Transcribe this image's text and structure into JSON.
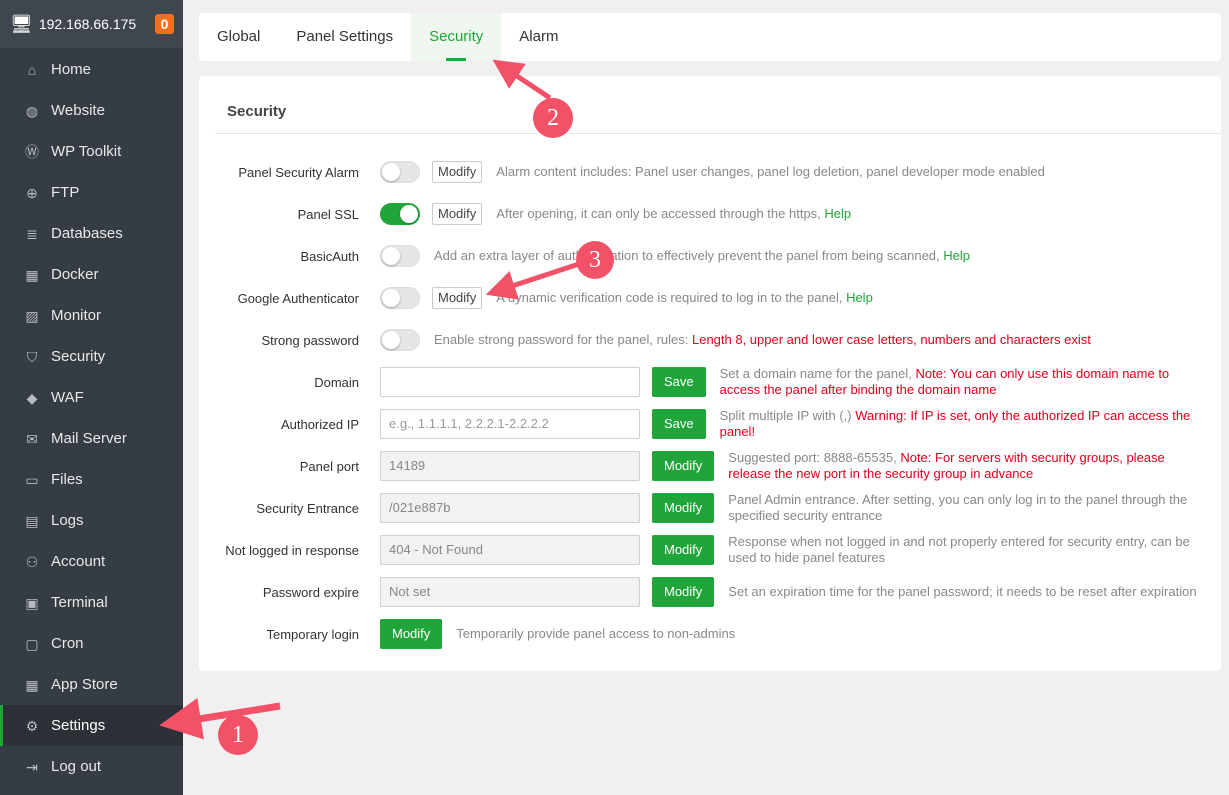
{
  "header": {
    "ip": "192.168.66.175",
    "badge": "0"
  },
  "sidebar": {
    "items": [
      {
        "label": "Home",
        "icon": "home-icon",
        "glyph": "⌂"
      },
      {
        "label": "Website",
        "icon": "globe-icon",
        "glyph": "◍"
      },
      {
        "label": "WP Toolkit",
        "icon": "wordpress-icon",
        "glyph": "Ⓦ"
      },
      {
        "label": "FTP",
        "icon": "ftp-icon",
        "glyph": "⊕"
      },
      {
        "label": "Databases",
        "icon": "database-icon",
        "glyph": "≣"
      },
      {
        "label": "Docker",
        "icon": "docker-icon",
        "glyph": "▦"
      },
      {
        "label": "Monitor",
        "icon": "monitor-icon",
        "glyph": "▨"
      },
      {
        "label": "Security",
        "icon": "shield-icon",
        "glyph": "⛉"
      },
      {
        "label": "WAF",
        "icon": "waf-shield-icon",
        "glyph": "◆"
      },
      {
        "label": "Mail Server",
        "icon": "mail-icon",
        "glyph": "✉"
      },
      {
        "label": "Files",
        "icon": "folder-icon",
        "glyph": "▭"
      },
      {
        "label": "Logs",
        "icon": "logs-icon",
        "glyph": "▤"
      },
      {
        "label": "Account",
        "icon": "user-icon",
        "glyph": "⚇"
      },
      {
        "label": "Terminal",
        "icon": "terminal-icon",
        "glyph": "▣"
      },
      {
        "label": "Cron",
        "icon": "cron-icon",
        "glyph": "▢"
      },
      {
        "label": "App Store",
        "icon": "apps-icon",
        "glyph": "▦"
      },
      {
        "label": "Settings",
        "icon": "gear-icon",
        "glyph": "⚙"
      },
      {
        "label": "Log out",
        "icon": "logout-icon",
        "glyph": "⇥"
      }
    ]
  },
  "tabs": [
    "Global",
    "Panel Settings",
    "Security",
    "Alarm"
  ],
  "section_title": "Security",
  "toggles": [
    {
      "label": "Panel Security Alarm",
      "on": false,
      "modify": "Modify",
      "desc": "Alarm content includes: Panel user changes, panel log deletion, panel developer mode enabled"
    },
    {
      "label": "Panel SSL",
      "on": true,
      "modify": "Modify",
      "desc": "After opening, it can only be accessed through the https, ",
      "help": "Help"
    },
    {
      "label": "BasicAuth",
      "on": false,
      "desc": "Add an extra layer of authentication to effectively prevent the panel from being scanned, ",
      "help": "Help"
    },
    {
      "label": "Google Authenticator",
      "on": false,
      "modify": "Modify",
      "desc": "A dynamic verification code is required to log in to the panel, ",
      "help": "Help"
    },
    {
      "label": "Strong password",
      "on": false,
      "desc": "Enable strong password for the panel, rules: ",
      "red": "Length 8, upper and lower case letters, numbers and characters exist"
    }
  ],
  "inputs": [
    {
      "label": "Domain",
      "value": "",
      "placeholder": "",
      "button": "Save",
      "desc": "Set a domain name for the panel, ",
      "red": "Note: You can only use this domain name to access the panel after binding the domain name"
    },
    {
      "label": "Authorized IP",
      "value": "",
      "placeholder": "e.g., 1.1.1.1, 2.2.2.1-2.2.2.2",
      "button": "Save",
      "desc": "Split multiple IP with (,) ",
      "red": "Warning: If IP is set, only the authorized IP can access the panel!"
    },
    {
      "label": "Panel port",
      "value": "14189",
      "button": "Modify",
      "desc": "Suggested port: 8888-65535, ",
      "red": "Note: For servers with security groups, please release the new port in the security group in advance"
    },
    {
      "label": "Security Entrance",
      "value": "/021e887b",
      "button": "Modify",
      "desc": "Panel Admin entrance. After setting, you can only log in to the panel through the specified security entrance"
    },
    {
      "label": "Not logged in response",
      "value": "404 - Not Found",
      "button": "Modify",
      "desc": "Response when not logged in and not properly entered for security entry, can be used to hide panel features"
    },
    {
      "label": "Password expire",
      "value": "Not set",
      "button": "Modify",
      "desc": "Set an expiration time for the panel password; it needs to be reset after expiration"
    }
  ],
  "temp_login": {
    "label": "Temporary login",
    "button": "Modify",
    "desc": "Temporarily provide panel access to non-admins"
  },
  "annotations": [
    "1",
    "2",
    "3"
  ],
  "colors": {
    "accent": "#20a53a",
    "sidebar": "#353c43",
    "warning": "#e0001b",
    "annotation": "#f25168"
  }
}
